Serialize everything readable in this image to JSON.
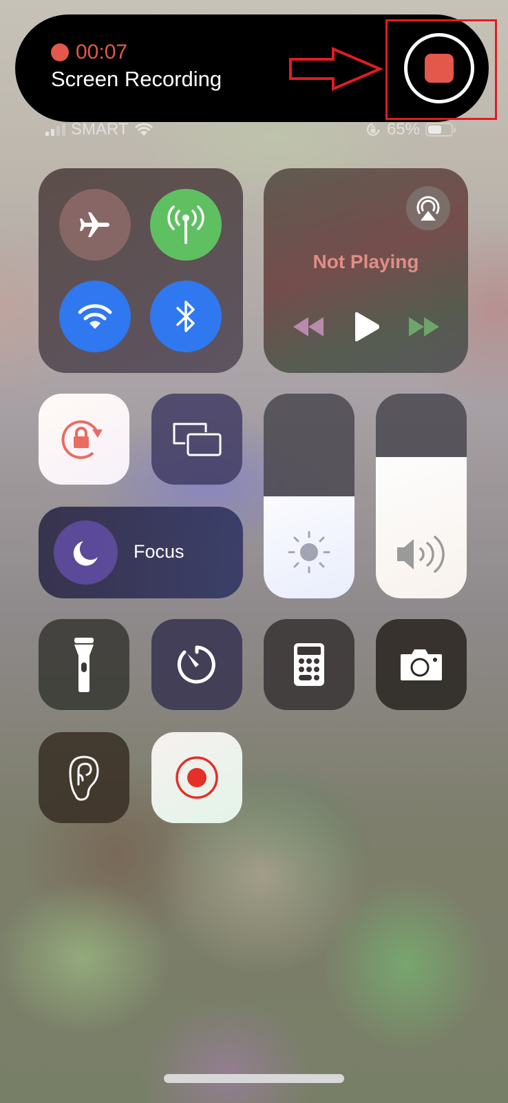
{
  "recording_banner": {
    "elapsed": "00:07",
    "label": "Screen Recording",
    "stop_button": "stop-recording",
    "annotation": "red-arrow-pointing-to-stop-button",
    "accent_color": "#e4574b"
  },
  "status_bar": {
    "carrier": "SMART",
    "signal_bars": 2,
    "signal_total": 4,
    "wifi": true,
    "orientation_lock": true,
    "battery_percent": "65%",
    "battery_level": 0.65
  },
  "connectivity": {
    "airplane_mode": {
      "icon": "airplane-icon",
      "on": false
    },
    "cellular_data": {
      "icon": "antenna-icon",
      "on": true,
      "color": "#5fc062"
    },
    "wifi": {
      "icon": "wifi-icon",
      "on": true,
      "color": "#2f78ef"
    },
    "bluetooth": {
      "icon": "bluetooth-icon",
      "on": true,
      "color": "#2f78ef"
    }
  },
  "media": {
    "status": "Not Playing",
    "airplay_icon": "airplay-icon",
    "controls": [
      "rewind",
      "play",
      "fast-forward"
    ]
  },
  "tiles": {
    "orientation_lock": {
      "icon": "rotation-lock-icon",
      "on": true
    },
    "screen_mirroring": {
      "icon": "screen-mirroring-icon"
    },
    "focus": {
      "label": "Focus",
      "icon": "moon-icon"
    },
    "flashlight": {
      "icon": "flashlight-icon"
    },
    "timer": {
      "icon": "timer-icon"
    },
    "calculator": {
      "icon": "calculator-icon"
    },
    "camera": {
      "icon": "camera-icon"
    },
    "hearing": {
      "icon": "ear-icon"
    },
    "screen_recording": {
      "icon": "record-icon",
      "on": true,
      "color": "#e53026"
    }
  },
  "sliders": {
    "brightness": {
      "level": 0.5,
      "icon": "sun-icon"
    },
    "volume": {
      "level": 0.69,
      "icon": "speaker-icon"
    }
  }
}
